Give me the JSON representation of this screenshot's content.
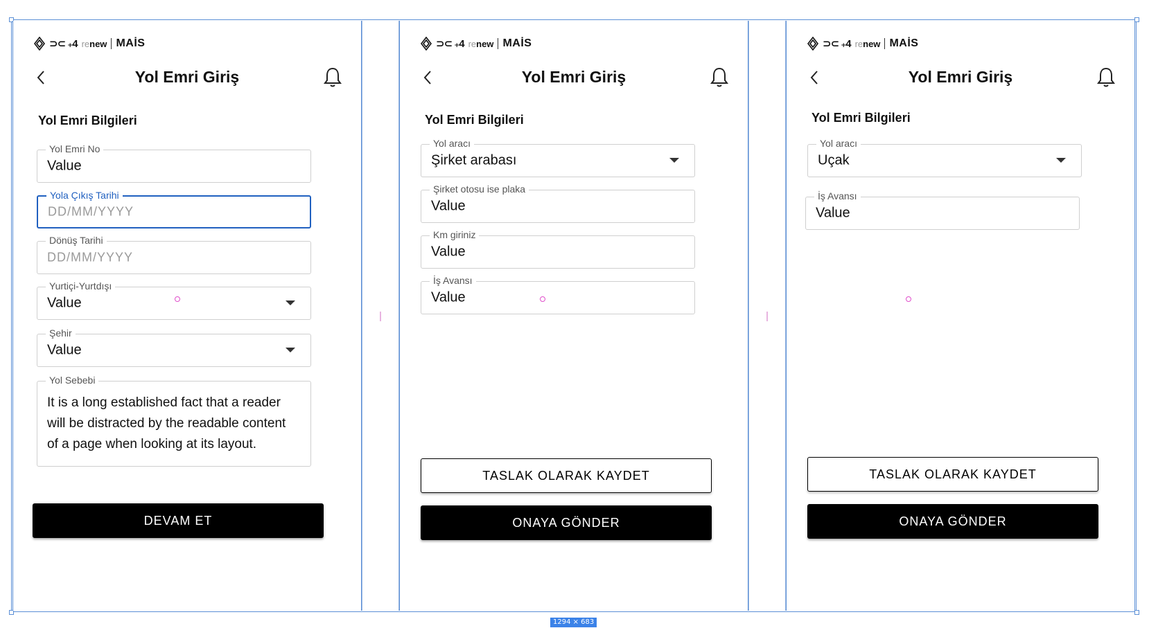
{
  "canvas": {
    "size_badge": "1294 × 683"
  },
  "brand": {
    "marks": "⊃⊂ ₊4",
    "renew_prefix": "re",
    "renew_suffix": "new",
    "mais": "MAİS"
  },
  "header": {
    "title": "Yol Emri Giriş"
  },
  "screen1": {
    "section_title": "Yol Emri Bilgileri",
    "fields": {
      "yol_emri_no": {
        "label": "Yol Emri No",
        "value": "Value"
      },
      "cikis_tarihi": {
        "label": "Yola Çıkış Tarihi",
        "placeholder": "DD/MM/YYYY"
      },
      "donus_tarihi": {
        "label": "Dönüş Tarihi",
        "placeholder": "DD/MM/YYYY"
      },
      "yurtici": {
        "label": "Yurtiçi-Yurtdışı",
        "value": "Value"
      },
      "sehir": {
        "label": "Şehir",
        "value": "Value"
      },
      "yol_sebebi": {
        "label": "Yol Sebebi",
        "value": "It is a long established fact that a reader will be distracted by the readable content of a page when looking at its layout."
      }
    },
    "continue_button": "DEVAM ET"
  },
  "screen2": {
    "section_title": "Yol Emri Bilgileri",
    "fields": {
      "yol_araci": {
        "label": "Yol aracı",
        "value": "Şirket arabası"
      },
      "plaka": {
        "label": "Şirket otosu ise plaka",
        "value": "Value"
      },
      "km": {
        "label": "Km giriniz",
        "value": "Value"
      },
      "avans": {
        "label": "İş Avansı",
        "value": "Value"
      }
    },
    "draft_button": "TASLAK OLARAK KAYDET",
    "submit_button": "ONAYA GÖNDER"
  },
  "screen3": {
    "section_title": "Yol Emri Bilgileri",
    "fields": {
      "yol_araci": {
        "label": "Yol aracı",
        "value": "Uçak"
      },
      "avans": {
        "label": "İş Avansı",
        "value": "Value"
      }
    },
    "draft_button": "TASLAK OLARAK KAYDET",
    "submit_button": "ONAYA GÖNDER"
  },
  "icons": [
    "renault-diamond-icon",
    "back-chevron-icon",
    "bell-icon",
    "dropdown-caret-icon"
  ],
  "colors": {
    "focus_blue": "#2060c0",
    "selection_blue": "#5b8fd6",
    "button_black": "#000000",
    "marker_pink": "#e04ecb"
  }
}
